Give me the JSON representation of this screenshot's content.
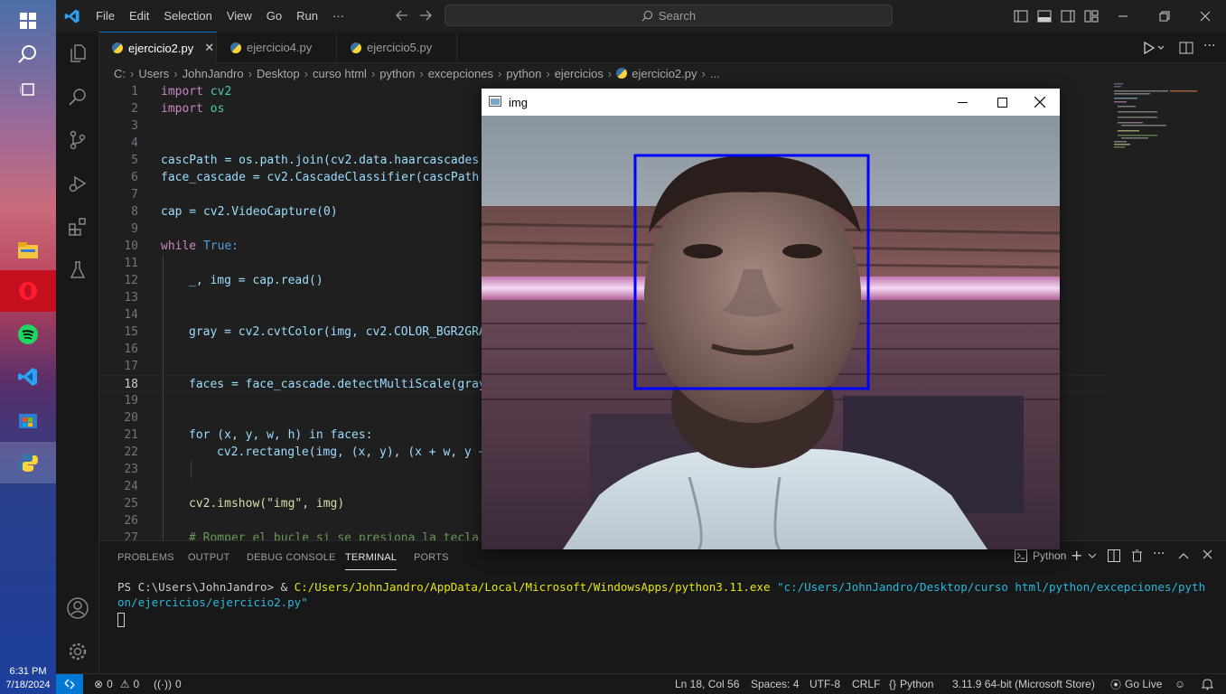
{
  "taskbar": {
    "time": "6:31 PM",
    "date": "7/18/2024"
  },
  "menu": [
    "File",
    "Edit",
    "Selection",
    "View",
    "Go",
    "Run",
    "···"
  ],
  "search": {
    "label": "Search"
  },
  "tabs": [
    {
      "label": "ejercicio2.py",
      "active": true
    },
    {
      "label": "ejercicio4.py",
      "active": false
    },
    {
      "label": "ejercicio5.py",
      "active": false
    }
  ],
  "breadcrumb": [
    "C:",
    "Users",
    "JohnJandro",
    "Desktop",
    "curso html",
    "python",
    "excepciones",
    "python",
    "ejercicios",
    "ejercicio2.py",
    "..."
  ],
  "code_lines": [
    {
      "n": "1"
    },
    {
      "n": "2"
    },
    {
      "n": "3"
    },
    {
      "n": "4"
    },
    {
      "n": "5"
    },
    {
      "n": "6"
    },
    {
      "n": "7"
    },
    {
      "n": "8"
    },
    {
      "n": "9"
    },
    {
      "n": "10"
    },
    {
      "n": "11"
    },
    {
      "n": "12"
    },
    {
      "n": "13"
    },
    {
      "n": "14"
    },
    {
      "n": "15"
    },
    {
      "n": "16"
    },
    {
      "n": "17"
    },
    {
      "n": "18"
    },
    {
      "n": "19"
    },
    {
      "n": "20"
    },
    {
      "n": "21"
    },
    {
      "n": "22"
    },
    {
      "n": "23"
    },
    {
      "n": "24"
    },
    {
      "n": "25"
    },
    {
      "n": "26"
    },
    {
      "n": "27"
    }
  ],
  "code_text": {
    "l1a": "import",
    "l1b": " cv2",
    "l2a": "import",
    "l2b": " os",
    "l5": "cascPath = os.path.join(cv2.data.haarcascades,",
    "l6": "face_cascade = cv2.CascadeClassifier(cascPath)",
    "l8": "cap = cv2.VideoCapture(0)",
    "l10a": "while",
    "l10b": " True:",
    "l12": "_, img = cap.read()",
    "l15": "gray = cv2.cvtColor(img, cv2.COLOR_BGR2GRA",
    "l18": "faces = face_cascade.detectMultiScale(gray",
    "l21": "for (x, y, w, h) in faces:",
    "l22": "cv2.rectangle(img, (x, y), (x + w, y +",
    "l25": "cv2.imshow(\"img\", img)",
    "l27": "# Romper el bucle si se presiona la tecla"
  },
  "panel": {
    "tabs": [
      "PROBLEMS",
      "OUTPUT",
      "DEBUG CONSOLE",
      "TERMINAL",
      "PORTS"
    ],
    "shell": "Python",
    "prompt": "PS C:\\Users\\JohnJandro> & ",
    "exe": "C:/Users/JohnJandro/AppData/Local/Microsoft/WindowsApps/python3.11.exe",
    "script": "\"c:/Users/JohnJandro/Desktop/curso html/python/excepciones/python/ejercicios/ejercicio2.py\""
  },
  "statusbar": {
    "errors": "0",
    "warnings": "0",
    "ports": "0",
    "position": "Ln 18, Col 56",
    "spaces": "Spaces: 4",
    "encoding": "UTF-8",
    "eol": "CRLF",
    "language": "Python",
    "interpreter": "3.11.9 64-bit (Microsoft Store)",
    "golive": "Go Live"
  },
  "img_window": {
    "title": "img",
    "face_box_color": "#0000ff"
  }
}
